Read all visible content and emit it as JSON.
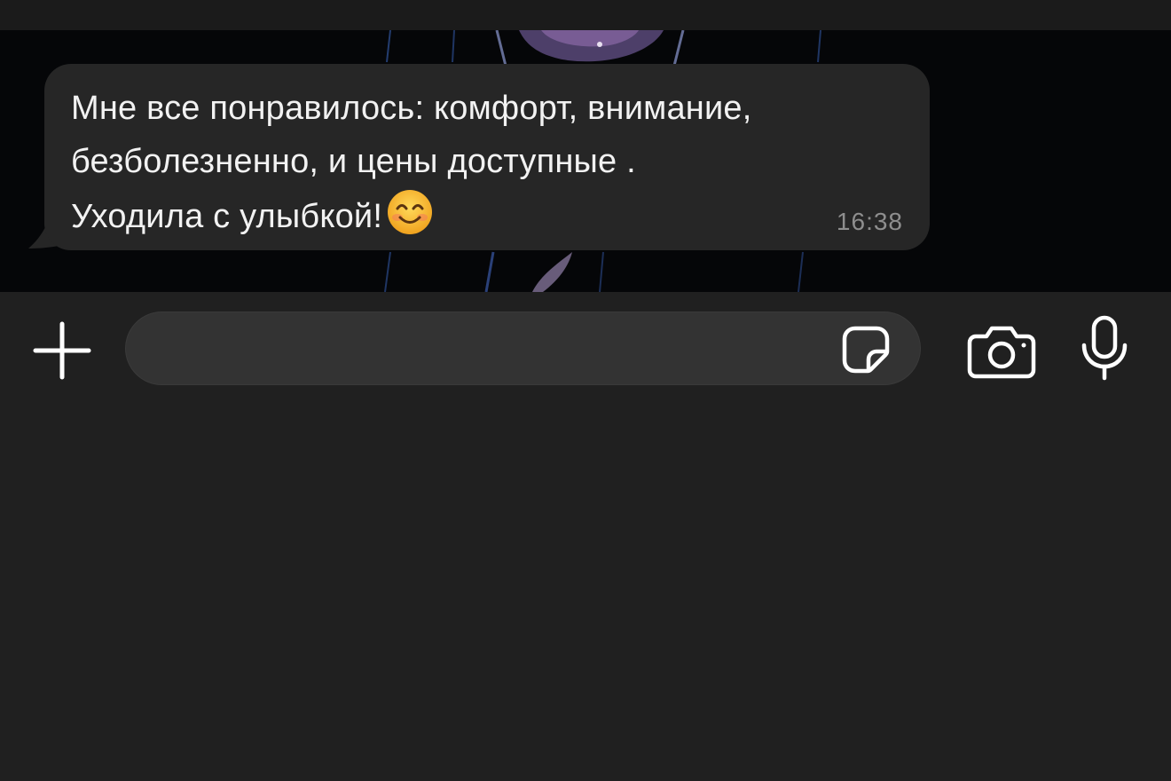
{
  "chat": {
    "message": {
      "lines": [
        "Мне все понравилось: комфорт, внимание,",
        "безболезненно, и цены доступные .",
        "Уходила с улыбкой!"
      ],
      "emoji": "smiling-face-with-smiling-eyes",
      "time": "16:38"
    }
  },
  "composer": {
    "input_value": "",
    "input_placeholder": "",
    "icons": {
      "attach": "plus-icon",
      "sticker": "sticker-icon",
      "camera": "camera-icon",
      "voice": "microphone-icon"
    }
  },
  "colors": {
    "background": "#202020",
    "bubble": "#262626",
    "message_text": "#f2f2f2",
    "time_text": "#8e8e8e",
    "input_field": "#333333",
    "icon": "#ffffff"
  }
}
